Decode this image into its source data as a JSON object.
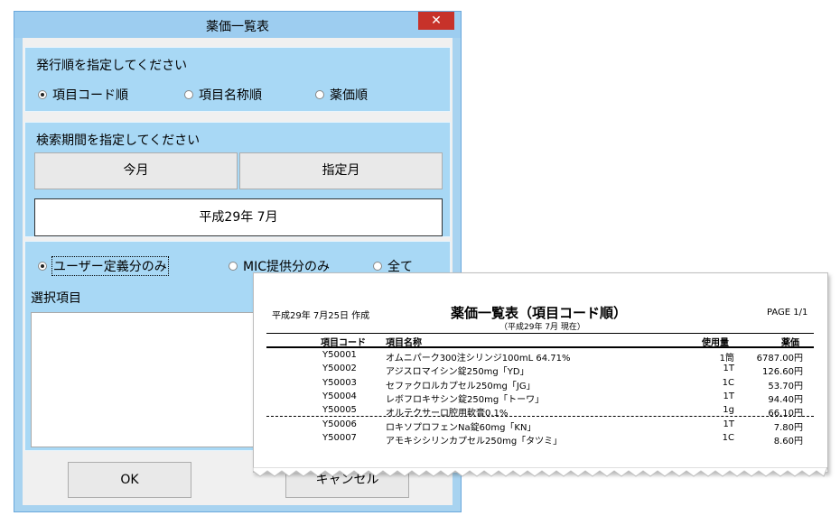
{
  "dialog": {
    "title": "薬価一覧表",
    "close_glyph": "✕",
    "order_group": {
      "label": "発行順を指定してください",
      "options": [
        {
          "label": "項目コード順",
          "selected": true
        },
        {
          "label": "項目名称順",
          "selected": false
        },
        {
          "label": "薬価順",
          "selected": false
        }
      ]
    },
    "period_group": {
      "label": "検索期間を指定してください",
      "this_month_label": "今月",
      "specified_month_label": "指定月",
      "period_value": "平成29年 7月"
    },
    "filter_group": {
      "options": [
        {
          "label": "ユーザー定義分のみ",
          "selected": true
        },
        {
          "label": "MIC提供分のみ",
          "selected": false
        },
        {
          "label": "全て",
          "selected": false
        }
      ],
      "selection_label": "選択項目"
    },
    "ok_label": "OK",
    "cancel_label": "キャンセル"
  },
  "report": {
    "created": "平成29年 7月25日 作成",
    "title": "薬価一覧表（項目コード順）",
    "subtitle": "（平成29年 7月 現在）",
    "page": "PAGE 1/1",
    "headers": {
      "code": "項目コード",
      "name": "項目名称",
      "usage": "使用量",
      "price": "薬価"
    },
    "rows": [
      {
        "code": "Y50001",
        "name": "オムニパーク300注シリンジ100mL 64.71%",
        "usage": "1筒",
        "price": "6787.00円"
      },
      {
        "code": "Y50002",
        "name": "アジスロマイシン錠250mg「YD」",
        "usage": "1T",
        "price": "126.60円"
      },
      {
        "code": "Y50003",
        "name": "セファクロルカプセル250mg「JG」",
        "usage": "1C",
        "price": "53.70円"
      },
      {
        "code": "Y50004",
        "name": "レボフロキサシン錠250mg「トーワ」",
        "usage": "1T",
        "price": "94.40円"
      },
      {
        "code": "Y50005",
        "name": "オルテクサーロ腔用軟膏0.1%",
        "usage": "1g",
        "price": "66.10円"
      },
      {
        "code": "Y50006",
        "name": "ロキソプロフェンNa錠60mg「KN」",
        "usage": "1T",
        "price": "7.80円"
      },
      {
        "code": "Y50007",
        "name": "アモキシシリンカプセル250mg「タツミ」",
        "usage": "1C",
        "price": "8.60円"
      }
    ]
  }
}
